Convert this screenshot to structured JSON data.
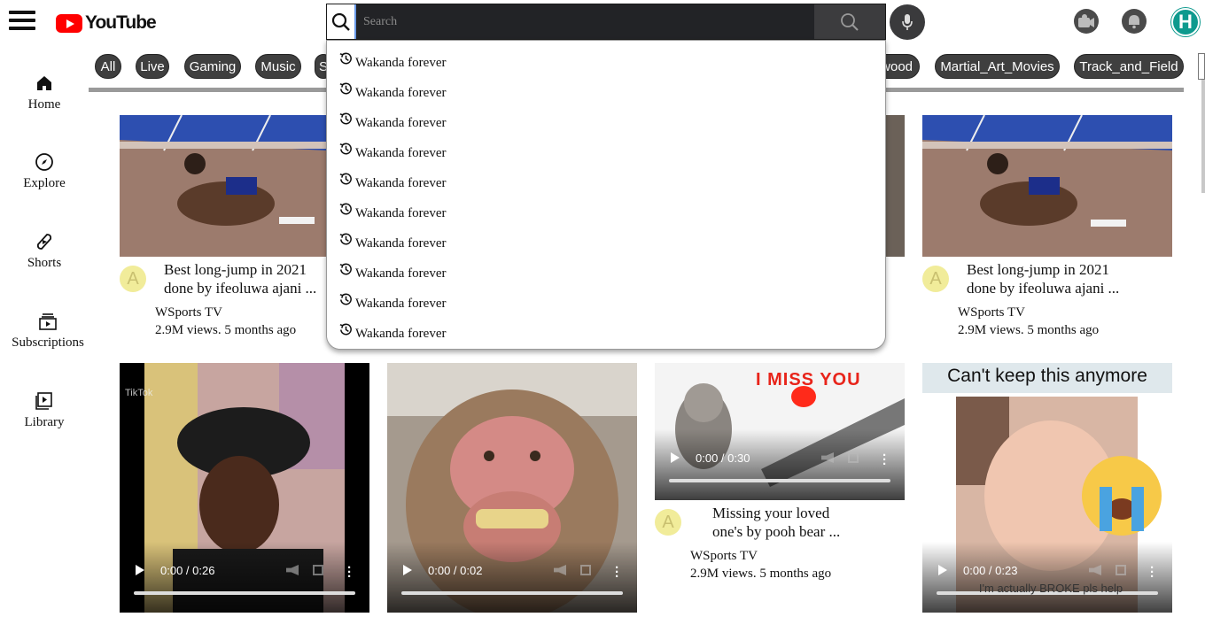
{
  "header": {
    "logo_text": "YouTube",
    "search_placeholder": "Search",
    "avatar_letter": "H",
    "icons": [
      "menu-icon",
      "search-icon",
      "mic-icon",
      "create-icon",
      "notifications-icon"
    ]
  },
  "sidebar": {
    "items": [
      {
        "label": "Home",
        "icon": "home-icon"
      },
      {
        "label": "Explore",
        "icon": "compass-icon"
      },
      {
        "label": "Shorts",
        "icon": "shorts-icon"
      },
      {
        "label": "Subscriptions",
        "icon": "subscriptions-icon"
      },
      {
        "label": "Library",
        "icon": "library-icon"
      }
    ]
  },
  "chips": [
    "All",
    "Live",
    "Gaming",
    "Music",
    "S",
    "wood",
    "Martial_Art_Movies",
    "Track_and_Field"
  ],
  "suggestions": [
    "Wakanda forever",
    "Wakanda forever",
    "Wakanda forever",
    "Wakanda forever",
    "Wakanda forever",
    "Wakanda forever",
    "Wakanda forever",
    "Wakanda forever",
    "Wakanda forever",
    "Wakanda forever"
  ],
  "cards": [
    {
      "avatar": "A",
      "title_line1": "Best long-jump in 2021",
      "title_line2": "done by ifeoluwa ajani ...",
      "channel": "WSports TV",
      "stats": "2.9M views. 5 months ago"
    },
    {
      "avatar": "A",
      "title_line1": "Best long-jump in 2021",
      "title_line2": "done by ifeoluwa ajani ...",
      "channel": "WSports TV",
      "stats": "2.9M views. 5 months ago"
    },
    {
      "avatar": "A",
      "title_line1": "Missing your loved",
      "title_line2": "one's by pooh bear ...",
      "channel": "WSports TV",
      "stats": "2.9M views. 5 months ago"
    }
  ],
  "videos": [
    {
      "time": "0:00 / 0:26",
      "watermark": "TikTok"
    },
    {
      "time": "0:00 / 0:02"
    },
    {
      "time": "0:00 / 0:30",
      "overlay_text": "I MISS YOU"
    },
    {
      "time": "0:00 / 0:23",
      "overlay_text": "Can't keep this anymore",
      "caption": "I'm actually BROKE pls help"
    }
  ],
  "colors": {
    "brand_red": "#ff0000",
    "chip_bg": "#3f3f3f",
    "avatar_teal": "#0e9a8e",
    "card_avatar": "#f1ec9a"
  }
}
